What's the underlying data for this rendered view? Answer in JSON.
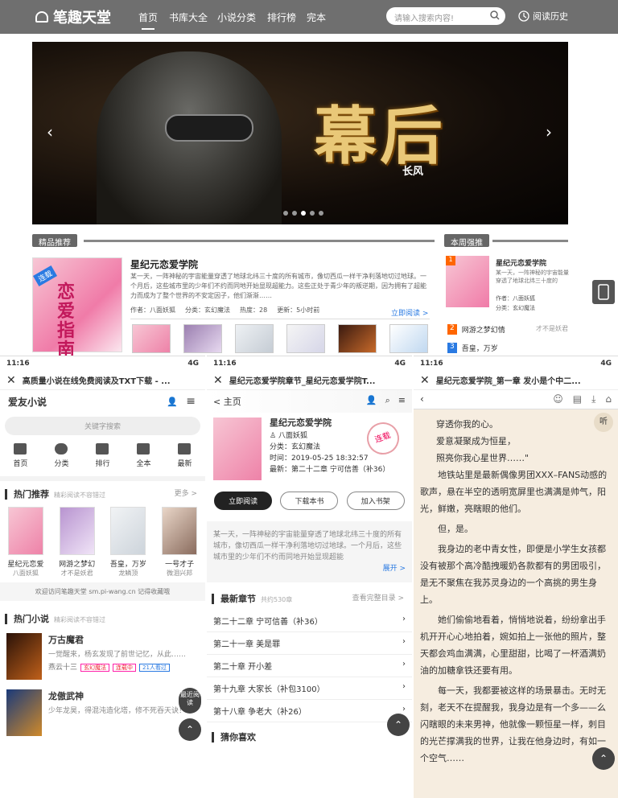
{
  "site": {
    "logo": "笔趣天堂",
    "nav": [
      "首页",
      "书库大全",
      "小说分类",
      "排行榜",
      "完本"
    ],
    "search_placeholder": "请输入搜索内容!",
    "history": "阅读历史"
  },
  "banner": {
    "title": "幕后",
    "author": "长风"
  },
  "recommend": {
    "header": "精品推荐",
    "badge": "连载",
    "book_title": "星纪元恋爱学院",
    "desc": "某一天，一阵神秘的宇宙能量穿透了地球北纬三十度的所有城市，像切西瓜一样干净利落地切过地球。一个月后，这些城市里的少年们不约而同地开始显现超能力。这些正处于青少年的叛逆期，因为拥有了超能力而成为了整个世界的不安定因子，他们渐渐……",
    "meta": [
      "作者：八面妖狐",
      "分类：玄幻魔法",
      "热度：28",
      "更新：5小时前"
    ],
    "read_btn": "立即阅读 >",
    "cover_text": "恋爱指南"
  },
  "weekly": {
    "header": "本周强推",
    "book_title": "星纪元恋爱学院",
    "desc": "某一天，一阵神秘的宇宙能量穿透了地球北纬三十度的",
    "author": "作者：八面妖狐",
    "category": "分类：玄幻魔法",
    "list": [
      {
        "rank": "2",
        "title": "网游之梦幻情",
        "author": "才不是妖君"
      },
      {
        "rank": "3",
        "title": "吾皇，万岁",
        "author": ""
      }
    ]
  },
  "phone1": {
    "time": "11:16",
    "signal": "4G",
    "title": "高质量小说在线免费阅读及TXT下载 - ...",
    "logo": "爱友小说",
    "search": "关键字搜索",
    "cats": [
      "首页",
      "分类",
      "排行",
      "全本",
      "最新"
    ],
    "hot_rec": "热门推荐",
    "hot_rec_sub": "精彩阅读不容错过",
    "more": "更多 >",
    "books": [
      {
        "title": "星纪元恋爱",
        "author": "八面妖狐"
      },
      {
        "title": "网游之梦幻",
        "author": "才不是妖君"
      },
      {
        "title": "吾皇，万岁",
        "author": "龙鳞顶"
      },
      {
        "title": "一号才子",
        "author": "微泪兴邦"
      }
    ],
    "promo": "欢迎访问笔趣天堂 sm.pi-wang.cn 记得收藏哦",
    "hot_novel": "热门小说",
    "hot_novel_sub": "精彩阅读不容错过",
    "novels": [
      {
        "title": "万古魔君",
        "desc": "一觉醒来，杨玄发现了前世记忆，从此……",
        "author": "燕云十三",
        "tags": [
          "玄幻魔法",
          "连载中",
          "21人看过"
        ]
      },
      {
        "title": "龙傲武神",
        "desc": "少年龙昊，得混沌造化塔，修不死吞天诀！",
        "author": "",
        "tags": []
      }
    ],
    "fab1": "最近阅读"
  },
  "phone2": {
    "time": "11:16",
    "signal": "4G",
    "title": "星纪元恋爱学院章节_星纪元恋爱学院T...",
    "back": "< 主页",
    "book_title": "星纪元恋爱学院",
    "author": "八面妖狐",
    "category": "分类：玄幻魔法",
    "time_label": "时间：2019-05-25 18:32:57",
    "latest": "最新：第二十二章 宁可信善（补36）",
    "stamp": "连载",
    "buttons": [
      "立即阅读",
      "下载本书",
      "加入书架"
    ],
    "intro": "某一天，一阵神秘的宇宙能量穿透了地球北纬三十度的所有城市，像切西瓜一样干净利落地切过地球。一个月后，这些城市里的少年们不约而同地开始显现超能",
    "expand": "展开 >",
    "chapters_title": "最新章节",
    "chapters_sub": "共约530章",
    "chapters_more": "查看完整目录 >",
    "chapters": [
      "第二十二章 宁可信善（补36）",
      "第二十一章 美是罪",
      "第二十章 开小差",
      "第十九章 大家长（补包3100）",
      "第十八章 争老大（补26）"
    ],
    "guess": "猜你喜欢"
  },
  "phone3": {
    "time": "11:16",
    "signal": "4G",
    "title": "星纪元恋爱学院_第一章 发小是个中二...",
    "paragraphs": [
      "穿透你我的心。",
      "爱意凝聚成为恒星，",
      "照亮你我心星世界……\"",
      "地铁站里是最新偶像男团XXX–FANS动感的歌声，悬在半空的透明宽屏里也满满是帅气，阳光，鲜嫩，亮瞎眼的他们。",
      "但，是。",
      "我身边的老中青女性，即便是小学生女孩都没有被那个高冷酷拽暖奶各款都有的男团吸引，是无不聚焦在我苏灵身边的一个高挑的男生身上。",
      "她们偷偷地看着，悄悄地说着，纷纷拿出手机开开心心地拍着，婉如拍上一张他的照片，整天都会鸡血满满，心里甜甜，比喝了一杯酒满奶油的加糖拿铁还要有用。",
      "每一天，我都要被这样的场景暴击。无时无刻，老天不在提醒我，我身边是有一个多——么闪瞎眼的未来男神，他就像一颗恒星一样，刺目的光芒撑满我的世界，让我在他身边时，有如一个空气……"
    ],
    "listen": "听"
  }
}
